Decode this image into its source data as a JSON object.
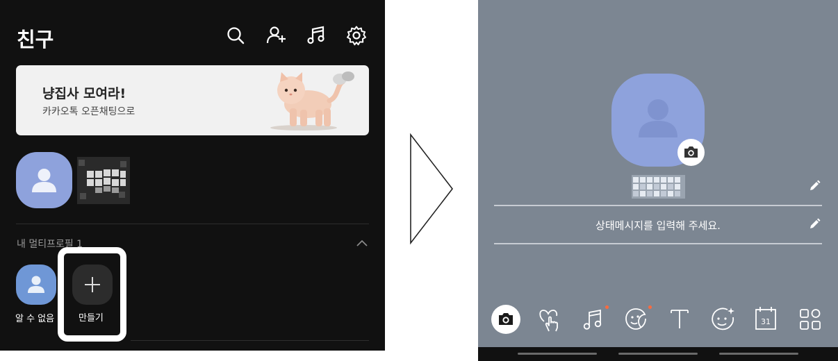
{
  "friends_screen": {
    "title": "친구",
    "icons": [
      "search-icon",
      "add-friend-icon",
      "music-icon",
      "settings-icon"
    ],
    "banner": {
      "title": "냥집사 모여라!",
      "subtitle": "카카오톡 오픈채팅으로"
    },
    "multi_profile": {
      "section_title": "내 멀티프로필 1",
      "items": [
        {
          "label": "알 수 없음"
        },
        {
          "label": "만들기"
        }
      ]
    }
  },
  "profile_edit_screen": {
    "status_placeholder": "상태메시지를 입력해 주세요.",
    "toolbar": {
      "calendar_day": "31",
      "icons": [
        "camera-icon",
        "heart-touch-icon",
        "music-icon",
        "sticker-icon",
        "text-icon",
        "effect-icon",
        "calendar-icon",
        "grid-icon"
      ]
    }
  },
  "colors": {
    "dark_bg": "#111111",
    "profile_bg": "#7c8692",
    "avatar_blue": "#8ea2dc",
    "highlight": "#ffffff",
    "notification_dot": "#ff6a3d"
  }
}
